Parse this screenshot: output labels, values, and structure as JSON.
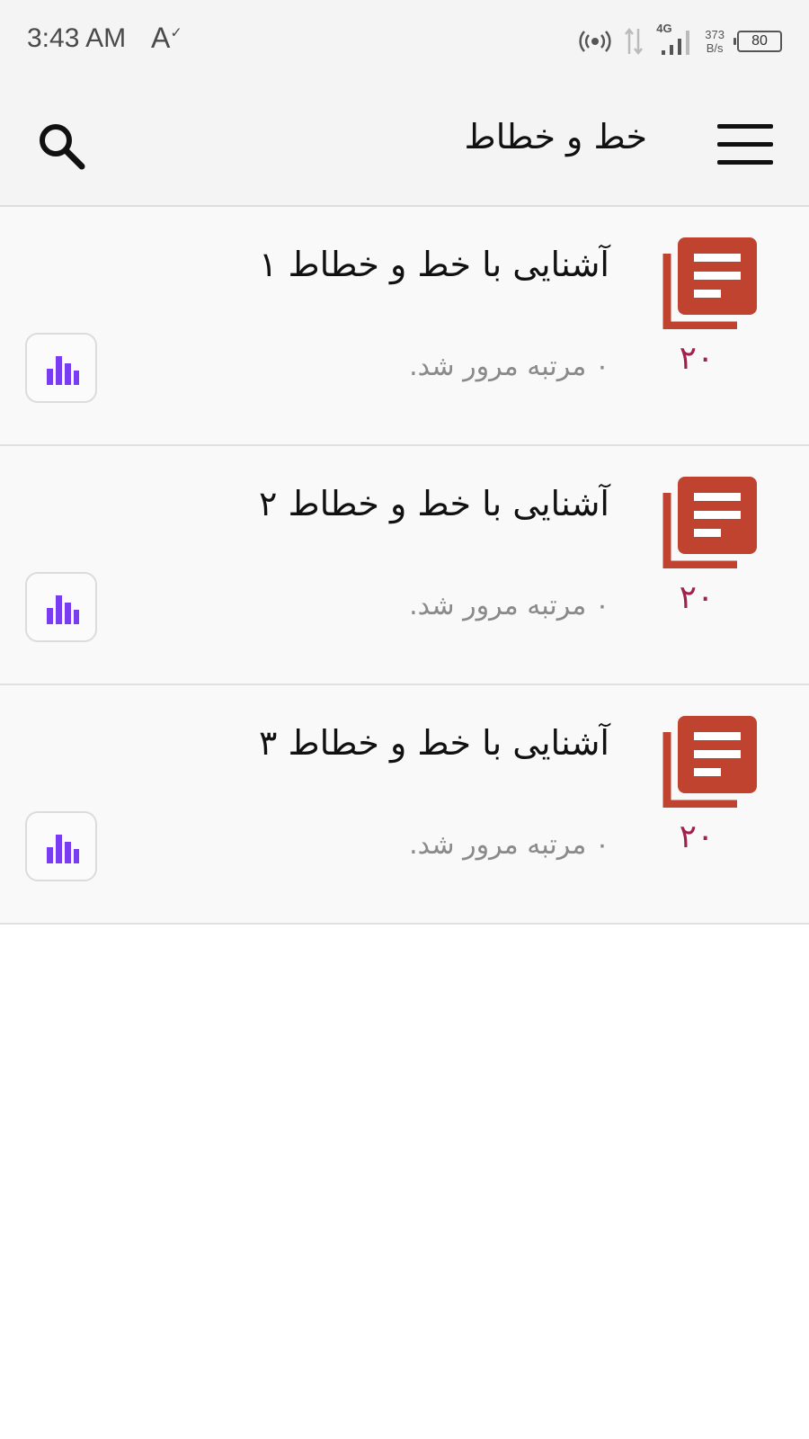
{
  "status_bar": {
    "time": "3:43 AM",
    "a_symbol": "A",
    "a_check": "✓",
    "network": "4G",
    "speed_value": "373",
    "speed_unit": "B/s",
    "battery": "80"
  },
  "app_bar": {
    "title": "خط و خطاط",
    "menu_icon": "hamburger-menu-icon",
    "search_icon": "search-icon"
  },
  "colors": {
    "doc_icon": "#c0432f",
    "count": "#a0224a",
    "stats_icon": "#7a3cf0"
  },
  "items": [
    {
      "title": "آشنایی با خط و خطاط ۱",
      "subtitle": "۰ مرتبه مرور شد.",
      "count": "۲۰",
      "icon": "document-stack-icon",
      "action_icon": "bar-chart-icon"
    },
    {
      "title": "آشنایی با خط و خطاط ۲",
      "subtitle": "۰ مرتبه مرور شد.",
      "count": "۲۰",
      "icon": "document-stack-icon",
      "action_icon": "bar-chart-icon"
    },
    {
      "title": "آشنایی با خط و خطاط ۳",
      "subtitle": "۰ مرتبه مرور شد.",
      "count": "۲۰",
      "icon": "document-stack-icon",
      "action_icon": "bar-chart-icon"
    }
  ]
}
